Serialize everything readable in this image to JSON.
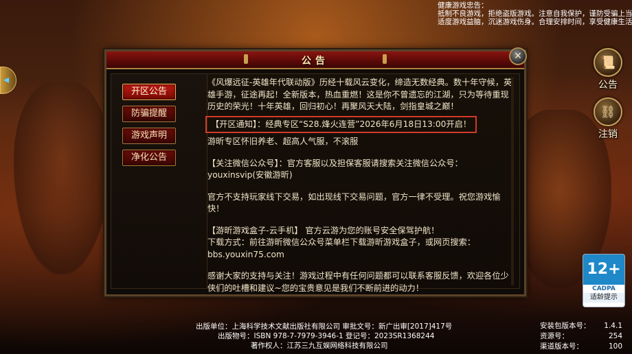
{
  "health_notice": {
    "title": "健康游戏忠告：",
    "line1": "抵制不良游戏，拒绝盗版游戏。注意自我保护，谨防受骗上当。",
    "line2": "适度游戏益脑，沉迷游戏伤身。合理安排时间，享受健康生活。"
  },
  "right_menu": {
    "announce_label": "公告",
    "logout_label": "注销"
  },
  "panel": {
    "title": "公告",
    "close_symbol": "✕",
    "tabs": [
      {
        "label": "开区公告",
        "active": true
      },
      {
        "label": "防骗提醒",
        "active": false
      },
      {
        "label": "游戏声明",
        "active": false
      },
      {
        "label": "净化公告",
        "active": false
      }
    ],
    "content": {
      "intro": "《风爆远征-英雄年代联动版》历经十载风云变化，缔造无数经典。数十年守候，英雄手游，征途再起！全新版本，热血重燃！这是你不曾遗忘的江湖，只为等待重现历史的荣光！十年英雄，回归初心！再聚风天大陆，剑指皇城之巅！",
      "open_notice": "【开区通知】：经典专区“S28.烽火连营”2026年6月18日13:00开启！",
      "zone_info": "游昕专区怀旧养老、超高人气服，不滚服",
      "wechat": "【关注微信公众号】：官方客服以及担保客服请搜索关注微信公众号：youxinsvip(安徽游昕)",
      "no_trade": "官方不支持玩家线下交易，如出现线下交易问题，官方一律不受理。祝您游戏愉快！",
      "box_title": "【游昕游戏盒子-云手机】 官方云游为您的账号安全保驾护航！",
      "box_download": "下载方式：前往游昕微信公众号菜单栏下载游昕游戏盒子，或网页搜索：bbs.youxin75.com",
      "thanks": "感谢大家的支持与关注！游戏过程中有任何问题都可以联系客服反馈，欢迎各位少侠们的吐槽和建议~您的宝贵意见是我们不断前进的动力！"
    }
  },
  "footer": {
    "line1": "出版单位：上海科学技术文献出版社有限公司 审批文号：新广出审[2017]417号",
    "line2": "出版物号：ISBN 978-7-7979-3946-1 登记号：2023SR1368244",
    "line3": "著作权人：江苏三九互娱网络科技有限公司"
  },
  "version": {
    "install_label": "安装包版本号：",
    "install_value": "1.4.1",
    "resource_label": "资源号：",
    "resource_value": "254",
    "channel_label": "渠道版本号：",
    "channel_value": "100"
  },
  "age_rating": {
    "number": "12+",
    "org": "CADPA",
    "tip": "适龄提示"
  }
}
